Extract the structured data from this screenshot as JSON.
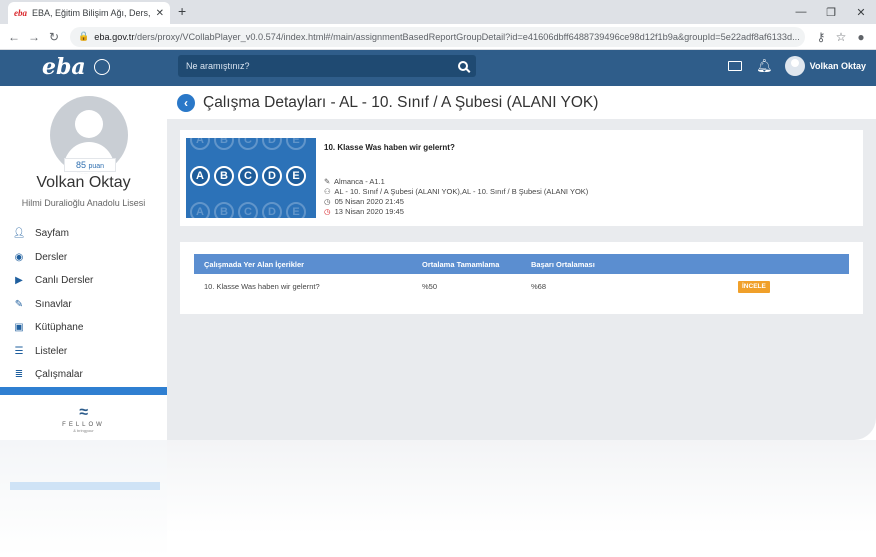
{
  "browser": {
    "tab_title": "EBA, Eğitim Bilişim Ağı, Ders, Hal",
    "tab_favicon": "eba",
    "tab_close": "✕",
    "new_tab": "+",
    "url_host": "eba.gov.tr",
    "url_rest": "/ders/proxy/VCollabPlayer_v0.0.574/index.html#/main/assignmentBasedReportGroupDetail?id=e41606dbff6488739496ce98d12f1b9a&groupId=5e22adf8af6133d..."
  },
  "header": {
    "logo": "eba",
    "search_placeholder": "Ne aramıştınız?",
    "user_name": "Volkan Oktay"
  },
  "sidebar": {
    "points_value": "85",
    "points_label": "puan",
    "profile_name": "Volkan Oktay",
    "school": "Hilmi Duralioğlu Anadolu Lisesi",
    "items": [
      {
        "label": "Sayfam",
        "icon": "user-icon"
      },
      {
        "label": "Dersler",
        "icon": "play-circle-icon"
      },
      {
        "label": "Canlı Dersler",
        "icon": "video-icon"
      },
      {
        "label": "Sınavlar",
        "icon": "pencil-icon"
      },
      {
        "label": "Kütüphane",
        "icon": "library-icon"
      },
      {
        "label": "Listeler",
        "icon": "list-icon"
      },
      {
        "label": "Çalışmalar",
        "icon": "assignments-icon"
      }
    ],
    "fellow_text": "FELLOW",
    "fellow_sub": "& bringyour"
  },
  "main": {
    "page_title": "Çalışma Detayları - AL - 10. Sınıf / A Şubesi (ALANI YOK)",
    "assignment": {
      "title": "10. Klasse Was haben wir gelernt?",
      "thumb_letters": [
        "A",
        "B",
        "C",
        "D",
        "E"
      ],
      "course": "Almanca - A1.1",
      "groups": "AL - 10. Sınıf / A Şubesi (ALANI YOK),AL - 10. Sınıf / B Şubesi (ALANI YOK)",
      "start_date": "05 Nisan 2020 21:45",
      "end_date": "13 Nisan 2020 19:45"
    },
    "table": {
      "headers": [
        "Çalışmada Yer Alan İçerikler",
        "Ortalama Tamamlama",
        "Başarı Ortalaması"
      ],
      "rows": [
        {
          "content": "10. Klasse Was haben wir gelernt?",
          "completion": "%50",
          "success": "%68",
          "action": "İNCELE"
        }
      ]
    }
  },
  "colors": {
    "header_blue": "#2f5d8a",
    "table_header_blue": "#5b8ed0",
    "button_orange": "#f0a02a",
    "back_button_blue": "#2a78c8"
  }
}
